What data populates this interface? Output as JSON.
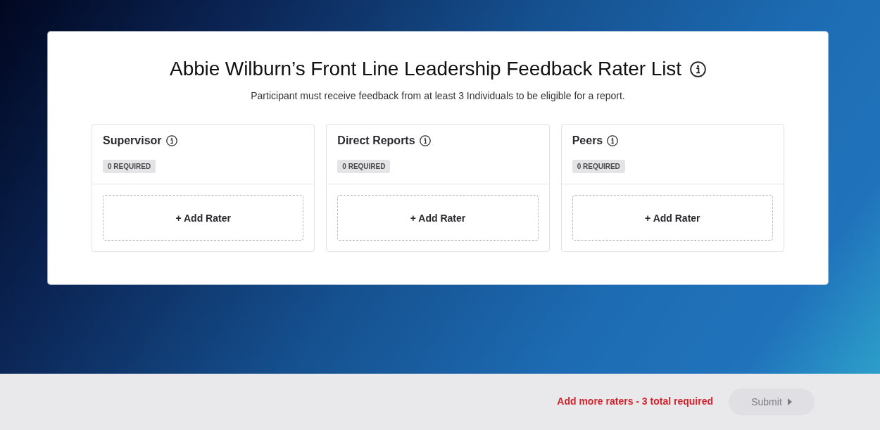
{
  "page": {
    "title": "Abbie Wilburn’s Front Line Leadership Feedback Rater List",
    "subtitle": "Participant must receive feedback from at least 3 Individuals to be eligible for a report."
  },
  "rater_groups": [
    {
      "name": "Supervisor",
      "requirement": "0 REQUIRED",
      "add_label": "+ Add Rater"
    },
    {
      "name": "Direct Reports",
      "requirement": "0 REQUIRED",
      "add_label": "+ Add Rater"
    },
    {
      "name": "Peers",
      "requirement": "0 REQUIRED",
      "add_label": "+ Add Rater"
    }
  ],
  "footer": {
    "warning": "Add more raters - 3 total required",
    "submit": {
      "label": "Submit",
      "disabled": true
    }
  }
}
